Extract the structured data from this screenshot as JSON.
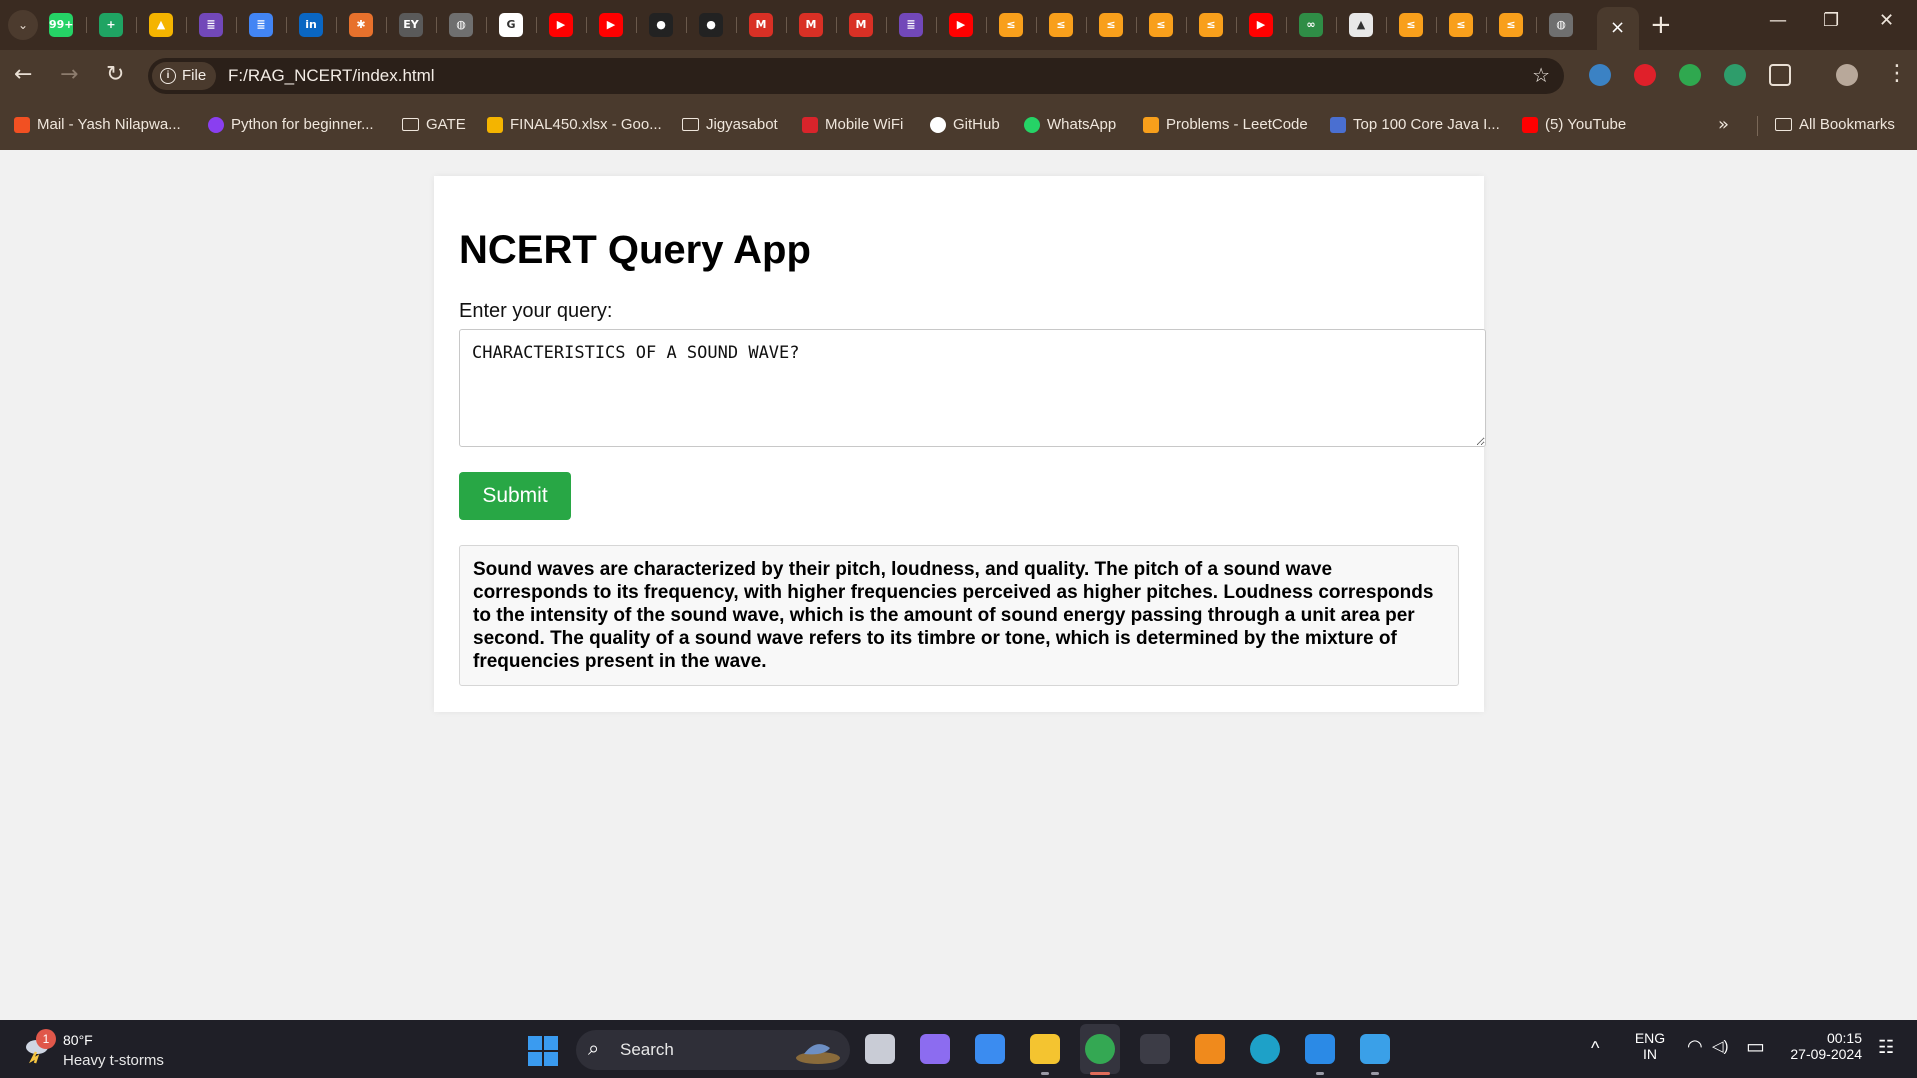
{
  "browser": {
    "url": "F:/RAG_NCERT/index.html",
    "site_chip": "File",
    "tab_close": "×",
    "new_tab": "+",
    "window_controls": {
      "minimize": "—",
      "restore": "❐",
      "close": "✕"
    },
    "nav": {
      "back": "←",
      "forward": "→",
      "reload": "↻"
    },
    "bookmark_star": "☆",
    "tab_favicons": [
      {
        "icon": "whatsapp-icon",
        "text": "99+",
        "color": "#25d366"
      },
      {
        "icon": "sheets-icon",
        "text": "+",
        "color": "#1fa463"
      },
      {
        "icon": "drive-icon",
        "text": "▲",
        "color": "#f4b400"
      },
      {
        "icon": "forms-icon",
        "text": "≣",
        "color": "#7248b9"
      },
      {
        "icon": "docs-icon",
        "text": "≣",
        "color": "#4285f4"
      },
      {
        "icon": "linkedin-icon",
        "text": "in",
        "color": "#0a66c2"
      },
      {
        "icon": "pinwheel-icon",
        "text": "✱",
        "color": "#e7712c"
      },
      {
        "icon": "ey-icon",
        "text": "EY",
        "color": "#5a5a5a"
      },
      {
        "icon": "globe-icon",
        "text": "◍",
        "color": "#6f6f6f"
      },
      {
        "icon": "google-icon",
        "text": "G",
        "color": "#ffffff"
      },
      {
        "icon": "youtube-icon",
        "text": "▶",
        "color": "#ff0000"
      },
      {
        "icon": "youtube-icon",
        "text": "▶",
        "color": "#ff0000"
      },
      {
        "icon": "github-icon",
        "text": "●",
        "color": "#222222"
      },
      {
        "icon": "github-icon",
        "text": "●",
        "color": "#222222"
      },
      {
        "icon": "gmail-icon",
        "text": "M",
        "color": "#d93025"
      },
      {
        "icon": "gmail-icon",
        "text": "M",
        "color": "#d93025"
      },
      {
        "icon": "gmail-icon",
        "text": "M",
        "color": "#d93025"
      },
      {
        "icon": "forms-icon",
        "text": "≣",
        "color": "#7248b9"
      },
      {
        "icon": "youtube-icon",
        "text": "▶",
        "color": "#ff0000"
      },
      {
        "icon": "leetcode-icon",
        "text": "≤",
        "color": "#f89f1b"
      },
      {
        "icon": "leetcode-icon",
        "text": "≤",
        "color": "#f89f1b"
      },
      {
        "icon": "leetcode-icon",
        "text": "≤",
        "color": "#f89f1b"
      },
      {
        "icon": "leetcode-icon",
        "text": "≤",
        "color": "#f89f1b"
      },
      {
        "icon": "leetcode-icon",
        "text": "≤",
        "color": "#f89f1b"
      },
      {
        "icon": "youtube-icon",
        "text": "▶",
        "color": "#ff0000"
      },
      {
        "icon": "gfg-icon",
        "text": "∞",
        "color": "#2f8d46"
      },
      {
        "icon": "rocket-icon",
        "text": "▲",
        "color": "#e8e8e8"
      },
      {
        "icon": "leetcode-icon",
        "text": "≤",
        "color": "#f89f1b"
      },
      {
        "icon": "leetcode-icon",
        "text": "≤",
        "color": "#f89f1b"
      },
      {
        "icon": "leetcode-icon",
        "text": "≤",
        "color": "#f89f1b"
      },
      {
        "icon": "globe-icon",
        "text": "◍",
        "color": "#6f6f6f"
      }
    ],
    "extensions": [
      {
        "icon": "extension-blue-icon",
        "color": "#3b82c4"
      },
      {
        "icon": "extension-red-lock-icon",
        "color": "#e0202a"
      },
      {
        "icon": "extension-shield-icon",
        "color": "#2fa84f"
      },
      {
        "icon": "extension-green-circle-icon",
        "color": "#2e9d6b"
      },
      {
        "icon": "extensions-puzzle-icon",
        "color": "#e9dfd4"
      },
      {
        "icon": "profile-avatar",
        "color": "#b8a89a"
      }
    ],
    "extensions_menu": "⋮",
    "bookmarks": [
      {
        "label": "Mail - Yash Nilapwa...",
        "icon": "microsoft-icon",
        "color": "#f25022"
      },
      {
        "label": "Python for beginner...",
        "icon": "python-course-icon",
        "color": "#8a3ff0"
      },
      {
        "label": "GATE",
        "icon": "folder-icon",
        "color": ""
      },
      {
        "label": "FINAL450.xlsx - Goo...",
        "icon": "drive-icon",
        "color": "#f4b400"
      },
      {
        "label": "Jigyasabot",
        "icon": "folder-icon",
        "color": ""
      },
      {
        "label": "Mobile WiFi",
        "icon": "wifi-router-icon",
        "color": "#d9242b"
      },
      {
        "label": "GitHub",
        "icon": "github-icon",
        "color": "#ffffff"
      },
      {
        "label": "WhatsApp",
        "icon": "whatsapp-icon",
        "color": "#25d366"
      },
      {
        "label": "Problems - LeetCode",
        "icon": "leetcode-icon",
        "color": "#f89f1b"
      },
      {
        "label": "Top 100 Core Java I...",
        "icon": "java-icon",
        "color": "#4a6fd1"
      },
      {
        "label": "(5) YouTube",
        "icon": "youtube-icon",
        "color": "#ff0000"
      }
    ],
    "bookmarks_overflow": "»",
    "all_bookmarks": "All Bookmarks"
  },
  "app": {
    "title": "NCERT Query App",
    "query_label": "Enter your query:",
    "query_value": "CHARACTERISTICS OF A SOUND WAVE?",
    "submit_label": "Submit",
    "response": "Sound waves are characterized by their pitch, loudness, and quality. The pitch of a sound wave corresponds to its frequency, with higher frequencies perceived as higher pitches. Loudness corresponds to the intensity of the sound wave, which is the amount of sound energy passing through a unit area per second. The quality of a sound wave refers to its timbre or tone, which is determined by the mixture of frequencies present in the wave."
  },
  "taskbar": {
    "weather": {
      "temp": "80°F",
      "condition": "Heavy t-storms",
      "badge": "1"
    },
    "search_label": "Search",
    "search_icon": "⌕",
    "apps": [
      {
        "icon": "task-view-icon",
        "color": "#c9ccd6"
      },
      {
        "icon": "copilot-icon",
        "color": "#8c6cf0"
      },
      {
        "icon": "microsoft-store-icon",
        "color": "#3b8cf0"
      },
      {
        "icon": "file-explorer-icon",
        "color": "#f4c430"
      },
      {
        "icon": "chrome-icon",
        "color": "#34a853"
      },
      {
        "icon": "terminal-icon",
        "color": "#3c3c46"
      },
      {
        "icon": "vlc-icon",
        "color": "#f08a1c"
      },
      {
        "icon": "edge-icon",
        "color": "#1ea1c8"
      },
      {
        "icon": "vscode-icon",
        "color": "#2b8ae6"
      },
      {
        "icon": "paint-icon",
        "color": "#3aa0e8"
      }
    ],
    "tray": {
      "chevron": "^",
      "lang_top": "ENG",
      "lang_bottom": "IN",
      "wifi": "◠",
      "volume": "◁)",
      "battery": "▭",
      "time": "00:15",
      "date": "27-09-2024",
      "notifications": "☷"
    }
  },
  "colors": {
    "accent_submit": "#28a745",
    "page_bg": "#f1f1f1",
    "chrome_frame": "#3a2b21",
    "chrome_toolbar": "#4a3a2d"
  }
}
